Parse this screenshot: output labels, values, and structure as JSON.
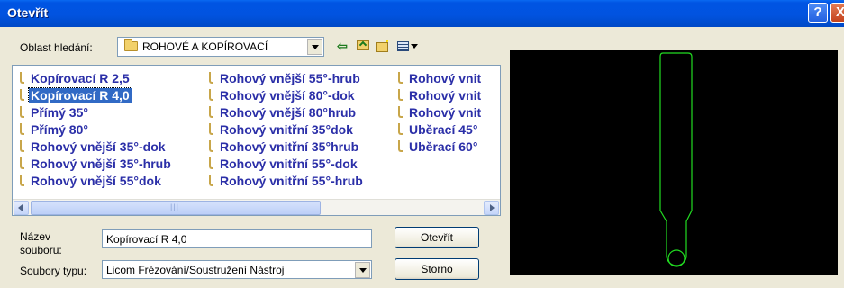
{
  "window": {
    "title": "Otevřít",
    "help_label": "?",
    "close_label": "X"
  },
  "lookin": {
    "label": "Oblast hledání:",
    "value": "ROHOVÉ A KOPÍROVACÍ"
  },
  "toolbar": {
    "icons": [
      "back-arrow-icon",
      "up-folder-icon",
      "new-folder-icon",
      "view-menu-icon"
    ]
  },
  "files": {
    "columns": [
      [
        "Kopírovací R 2,5",
        "Kopírovací R 4,0",
        "Přímý 35°",
        "Přímý 80°",
        "Rohový vnější 35°-dok",
        "Rohový vnější 35°-hrub",
        "Rohový vnější 55°dok"
      ],
      [
        "Rohový vnější 55°-hrub",
        "Rohový vnější 80°-dok",
        "Rohový vnější 80°hrub",
        "Rohový vnitřní 35°dok",
        "Rohový vnitřní 35°hrub",
        "Rohový vnitřní 55°-dok",
        "Rohový vnitřní 55°-hrub"
      ],
      [
        "Rohový vnit",
        "Rohový vnit",
        "Rohový vnit",
        "Uběrací 45°",
        "Uběrací 60°"
      ]
    ],
    "selected": "Kopírovací R 4,0"
  },
  "filename": {
    "label_line1": "Název",
    "label_line2": "souboru:",
    "value": "Kopírovací R 4,0"
  },
  "filetype": {
    "label": "Soubory typu:",
    "value": "Licom Frézování/Soustružení Nástroj"
  },
  "buttons": {
    "open": "Otevřít",
    "cancel": "Storno"
  },
  "colors": {
    "title_bar": "#0054e3",
    "file_text": "#2b2fa8",
    "selection": "#316ac5",
    "preview_bg": "#000000",
    "preview_line": "#22dd22"
  }
}
